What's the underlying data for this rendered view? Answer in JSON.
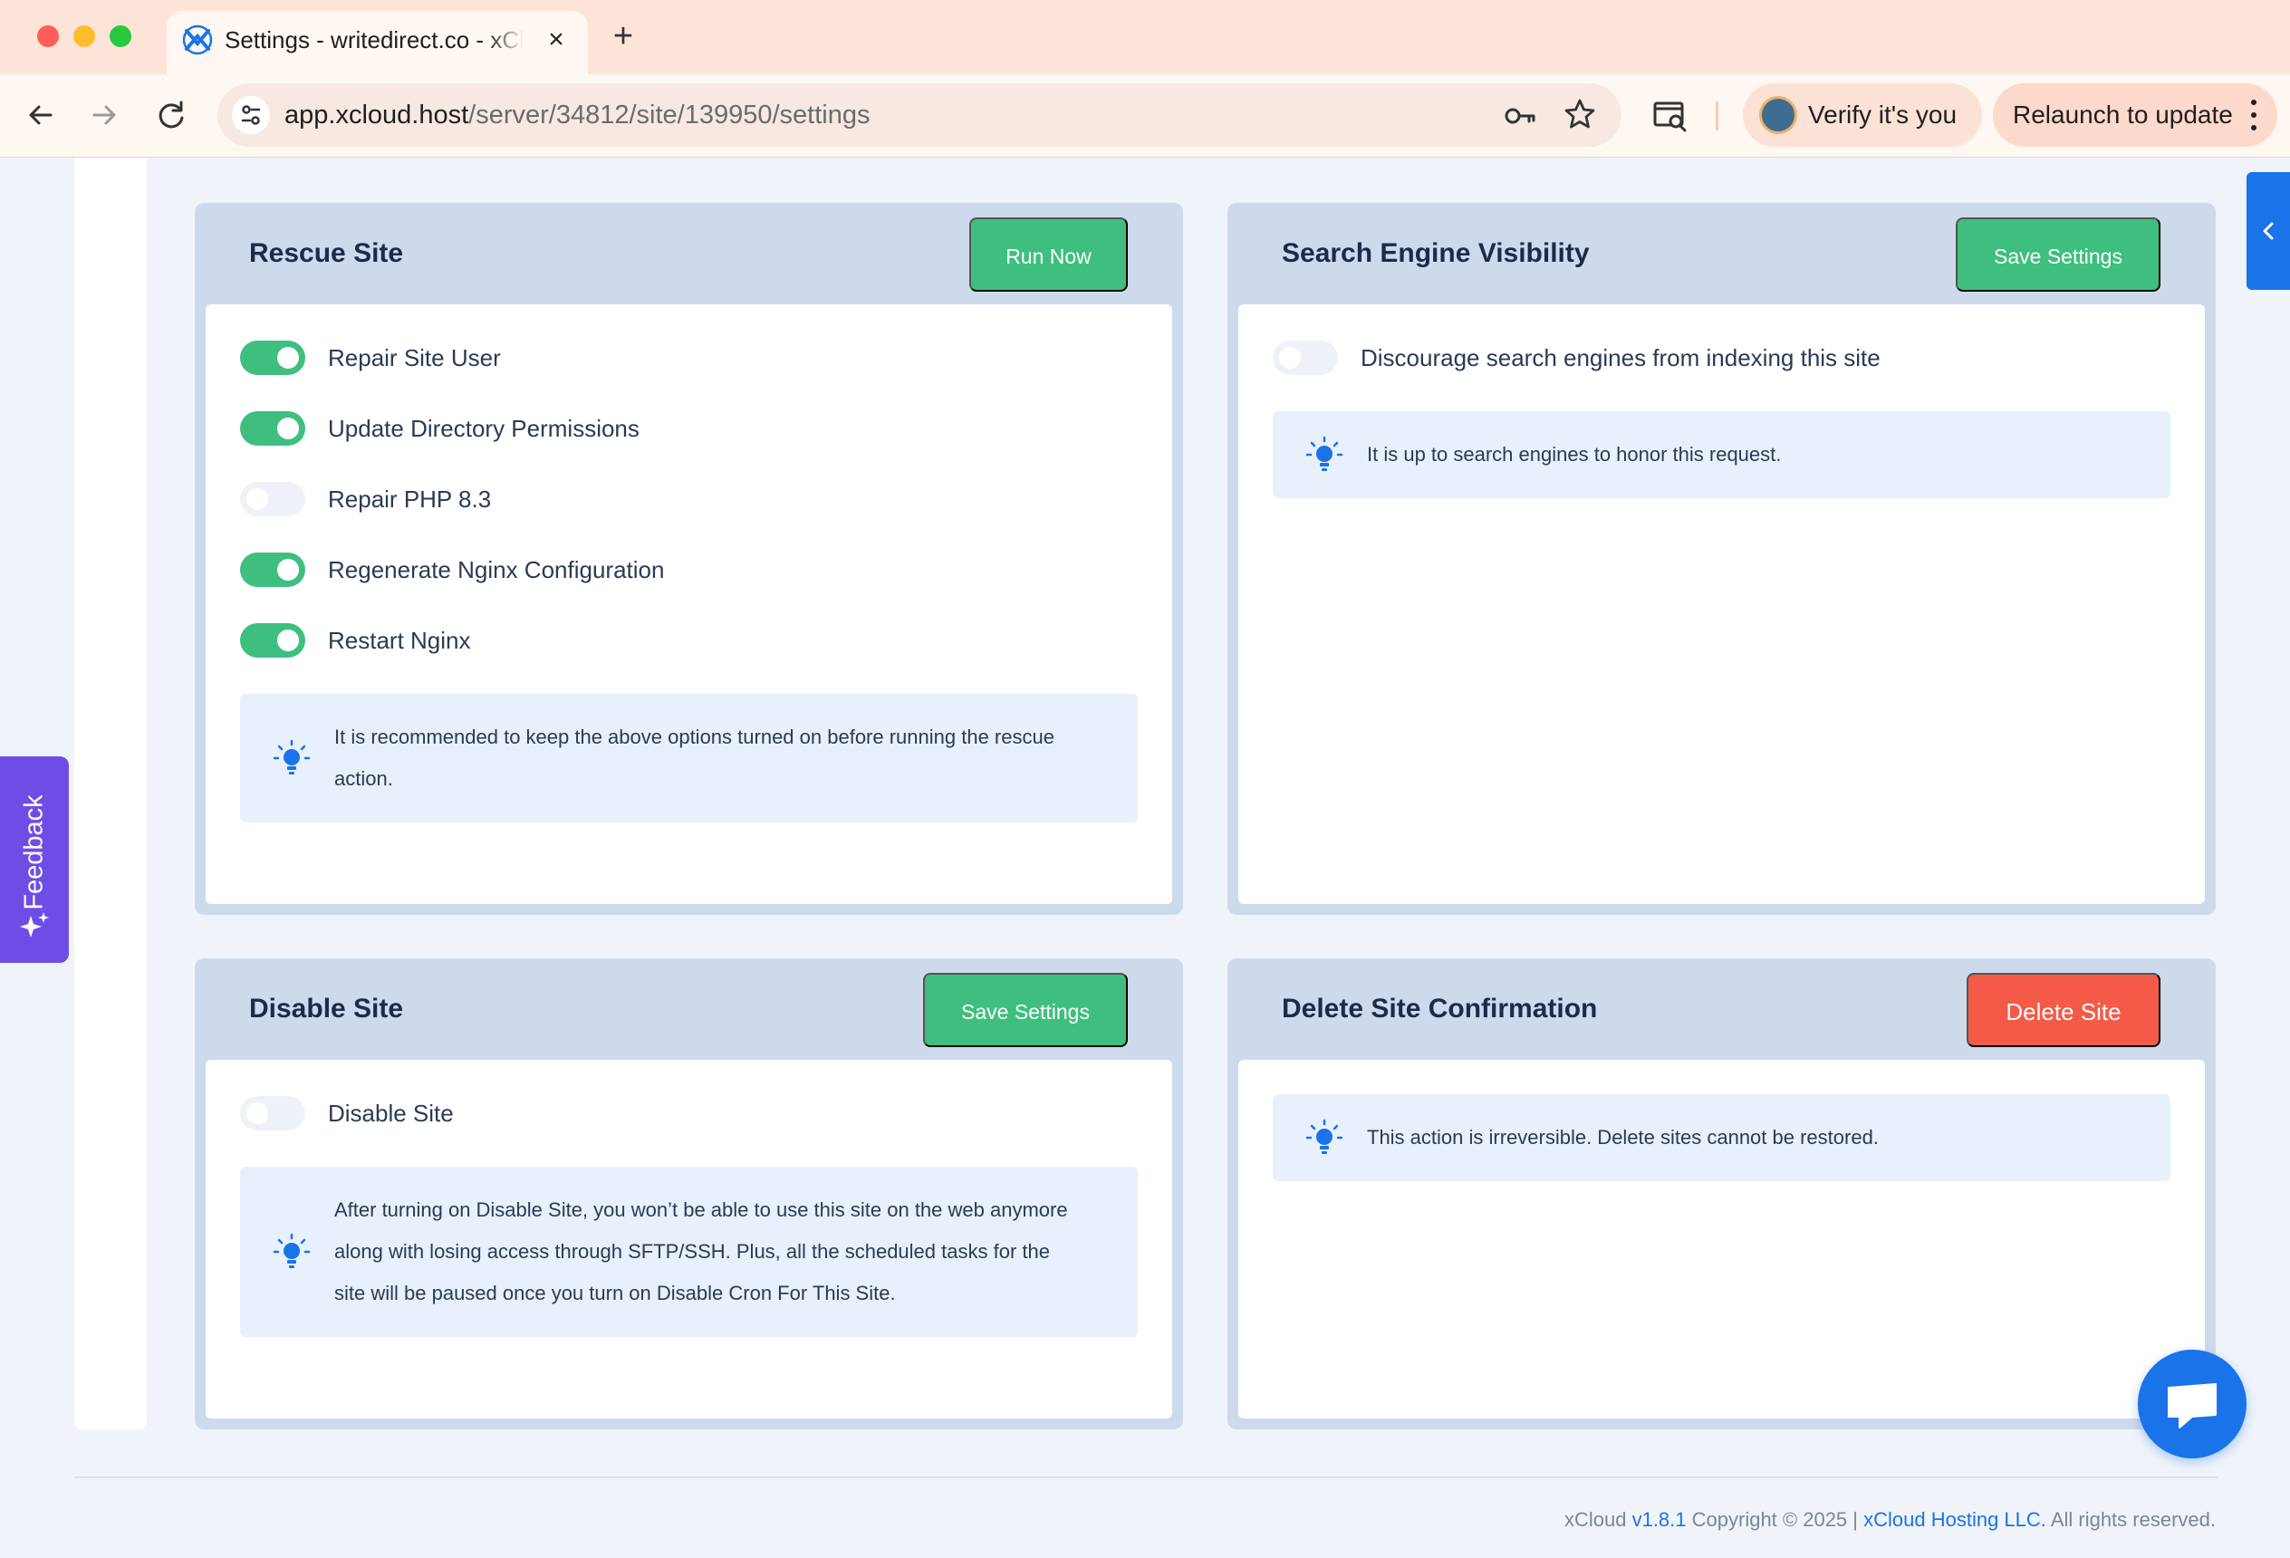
{
  "browser": {
    "tab_title": "Settings - writedirect.co - xCloud",
    "url_host": "app.xcloud.host",
    "url_path": "/server/34812/site/139950/settings",
    "verify_label": "Verify it's you",
    "relaunch_label": "Relaunch to update"
  },
  "feedback": {
    "label": "Feedback"
  },
  "rescue": {
    "title": "Rescue Site",
    "button": "Run Now",
    "options": [
      {
        "label": "Repair Site User",
        "on": true
      },
      {
        "label": "Update Directory Permissions",
        "on": true
      },
      {
        "label": "Repair PHP 8.3",
        "on": false
      },
      {
        "label": "Regenerate Nginx Configuration",
        "on": true
      },
      {
        "label": "Restart Nginx",
        "on": true
      }
    ],
    "note": "It is recommended to keep the above options turned on before running the rescue action."
  },
  "seo": {
    "title": "Search Engine Visibility",
    "button": "Save Settings",
    "toggle_label": "Discourage search engines from indexing this site",
    "toggle_on": false,
    "note": "It is up to search engines to honor this request."
  },
  "disable": {
    "title": "Disable Site",
    "button": "Save Settings",
    "toggle_label": "Disable Site",
    "toggle_on": false,
    "note": "After turning on Disable Site, you won’t be able to use this site on the web anymore along with losing access through SFTP/SSH. Plus, all the scheduled tasks for the site will be paused once you turn on Disable Cron For This Site."
  },
  "delete": {
    "title": "Delete Site Confirmation",
    "button": "Delete Site",
    "note": "This action is irreversible. Delete sites cannot be restored."
  },
  "footer": {
    "brand": "xCloud",
    "version": "v1.8.1",
    "copyright": "Copyright © 2025 |",
    "company": "xCloud Hosting LLC.",
    "rights": "All rights reserved."
  },
  "colors": {
    "accent_green": "#3fbf7f",
    "danger_red": "#f45a47",
    "link_blue": "#1a73e8",
    "feedback_purple": "#6d4de6"
  }
}
